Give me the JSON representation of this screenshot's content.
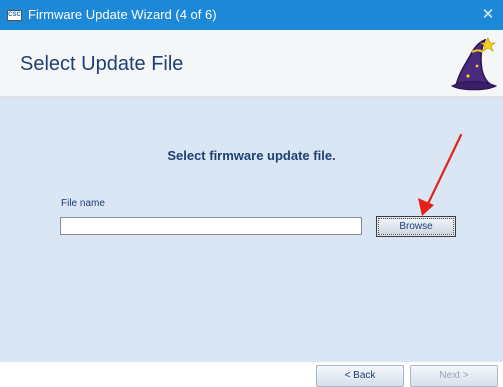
{
  "window": {
    "title": "Firmware Update Wizard (4 of 6)",
    "app_icon_text": "CSC",
    "close_glyph": "✕"
  },
  "header": {
    "title": "Select Update File",
    "icon": "wizard-hat-icon"
  },
  "main": {
    "instruction": "Select firmware update file.",
    "file_label": "File name",
    "file_value": "",
    "browse_label": "Browse"
  },
  "footer": {
    "back_label": "< Back",
    "next_label": "Next >",
    "next_enabled": false
  },
  "annotation": {
    "arrow_color": "#e2231a"
  },
  "colors": {
    "titlebar": "#1e88d8",
    "header_bg": "#f5f6f7",
    "content_bg": "#dae6f4",
    "text_blue": "#1f3f75"
  }
}
